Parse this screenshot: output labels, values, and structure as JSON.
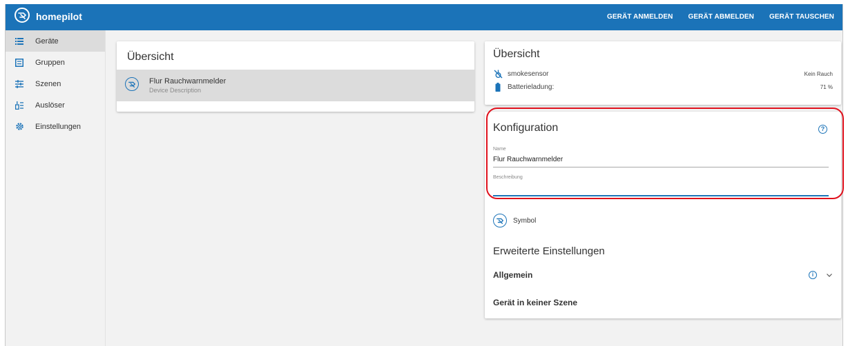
{
  "app": {
    "brand": "homepilot",
    "logo_icon": "homepilot-logo-icon",
    "colors": {
      "primary": "#1b73b8",
      "highlight": "#e0101c"
    }
  },
  "topnav": [
    {
      "label": "GERÄT ANMELDEN"
    },
    {
      "label": "GERÄT ABMELDEN"
    },
    {
      "label": "GERÄT TAUSCHEN"
    }
  ],
  "sidebar": {
    "items": [
      {
        "label": "Geräte",
        "icon": "list-icon",
        "active": true
      },
      {
        "label": "Gruppen",
        "icon": "groups-icon",
        "active": false
      },
      {
        "label": "Szenen",
        "icon": "scenes-icon",
        "active": false
      },
      {
        "label": "Auslöser",
        "icon": "trigger-icon",
        "active": false
      },
      {
        "label": "Einstellungen",
        "icon": "gear-icon",
        "active": false
      }
    ]
  },
  "overview_left": {
    "title": "Übersicht",
    "devices": [
      {
        "name": "Flur Rauchwarnmelder",
        "description": "Device Description",
        "icon": "device-symbol-icon"
      }
    ]
  },
  "overview_right": {
    "title": "Übersicht",
    "properties": [
      {
        "label": "smokesensor",
        "value": "Kein Rauch",
        "icon": "smoke-sensor-icon"
      },
      {
        "label": "Batterieladung:",
        "value": "71 %",
        "icon": "battery-icon"
      }
    ]
  },
  "config": {
    "title": "Konfiguration",
    "help_icon": "help-icon",
    "name_label": "Name",
    "name_value": "Flur Rauchwarnmelder",
    "description_label": "Beschreibung",
    "description_value": "",
    "symbol_label": "Symbol",
    "advanced_title": "Erweiterte Einstellungen",
    "general_label": "Allgemein",
    "no_scene_label": "Gerät in keiner Szene"
  }
}
